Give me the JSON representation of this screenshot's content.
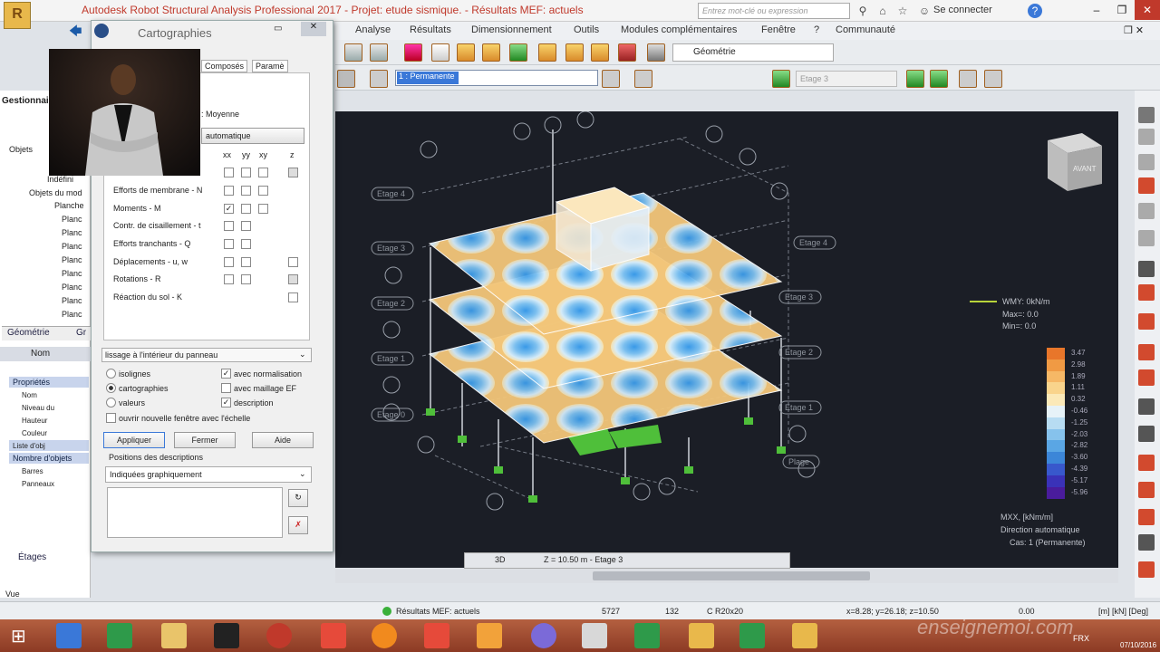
{
  "window": {
    "title": "Autodesk Robot Structural Analysis Professional 2017 - Projet: etude sismique. - Résultats MEF: actuels",
    "search_placeholder": "Entrez mot-clé ou expression",
    "connect": "Se connecter"
  },
  "menu": [
    "Analyse",
    "Résultats",
    "Dimensionnement",
    "Outils",
    "Modules complémentaires",
    "Fenêtre",
    "?",
    "Communauté"
  ],
  "toolbar": {
    "geometry_select": "Géométrie",
    "case_select": "1 : Permanente",
    "etage_select": "Etage 3"
  },
  "left_panel": {
    "header": "Gestionnaire",
    "tree": [
      "Objets",
      "Indéfini",
      "Objets du mod",
      "Planche",
      "Planc",
      "Planc",
      "Planc",
      "Planc",
      "Planc",
      "Planc",
      "Planc",
      "Planc"
    ],
    "tabs": [
      "Géométrie",
      "Gr"
    ],
    "prop_header": "Nom",
    "props": [
      "Propriétés",
      "Nom",
      "Niveau du",
      "Hauteur",
      "Couleur",
      "Liste d'obj",
      "Nombre d'objets",
      "Barres",
      "Panneaux"
    ],
    "bottom_tab": "Étages",
    "vue": "Vue"
  },
  "carto": {
    "title": "Cartographies",
    "tabs": [
      "Composés",
      "Paramè"
    ],
    "moyenne": ": Moyenne",
    "auto": "automatique",
    "cols": [
      "xx",
      "yy",
      "xy",
      "z"
    ],
    "rows": [
      "Efforts de membrane - N",
      "Moments - M",
      "Contr. de cisaillement - t",
      "Efforts tranchants - Q",
      "Déplacements - u, w",
      "Rotations - R",
      "Réaction du sol - K"
    ],
    "lissage": "lissage à l'intérieur du panneau",
    "opt_isolignes": "isolignes",
    "opt_carto": "cartographies",
    "opt_valeurs": "valeurs",
    "opt_normal": "avec normalisation",
    "opt_maillage": "avec maillage EF",
    "opt_desc": "description",
    "opt_newwin": "ouvrir nouvelle fenêtre avec l'échelle",
    "btn_apply": "Appliquer",
    "btn_close": "Fermer",
    "btn_help": "Aide",
    "pos_label": "Positions des descriptions",
    "pos_value": "Indiquées graphiquement"
  },
  "viewport": {
    "view_mode": "3D",
    "z_info": "Z = 10.50 m - Etage 3",
    "cube_label": "AVANT",
    "wmy": "WMY: 0kN/m",
    "max": "Max=: 0.0",
    "min": "Min=: 0.0",
    "legend_values": [
      "3.47",
      "2.98",
      "1.89",
      "1.11",
      "0.32",
      "-0.46",
      "-1.25",
      "-2.03",
      "-2.82",
      "-3.60",
      "-4.39",
      "-5.17",
      "-5.96"
    ],
    "legend_colors": [
      "#e8762a",
      "#f09a44",
      "#f6b866",
      "#f9d48c",
      "#fbe9b8",
      "#e6f2f8",
      "#b7dcf2",
      "#86c2ec",
      "#5aa6e4",
      "#3c86d8",
      "#3858cc",
      "#3a32b8",
      "#4a1c9c"
    ],
    "caption1": "MXX, [kNm/m]",
    "caption2": "Direction automatique",
    "caption3": "Cas: 1 (Permanente)",
    "etages": [
      "Etage 4",
      "Etage 3",
      "Etage 2",
      "Etage 1",
      "Etage 0",
      "Etage 4",
      "Etage 3",
      "Etage 2",
      "Etage 1",
      "Plage"
    ]
  },
  "status": {
    "results": "Résultats MEF: actuels",
    "n1": "5727",
    "n2": "132",
    "section": "C R20x20",
    "coords": "x=8.28; y=26.18; z=10.50",
    "value": "0.00",
    "units": "[m] [kN] [Deg]"
  },
  "taskbar": {
    "lang": "FRX",
    "date": "07/10/2016",
    "watermark": "enseignemoi.com"
  }
}
